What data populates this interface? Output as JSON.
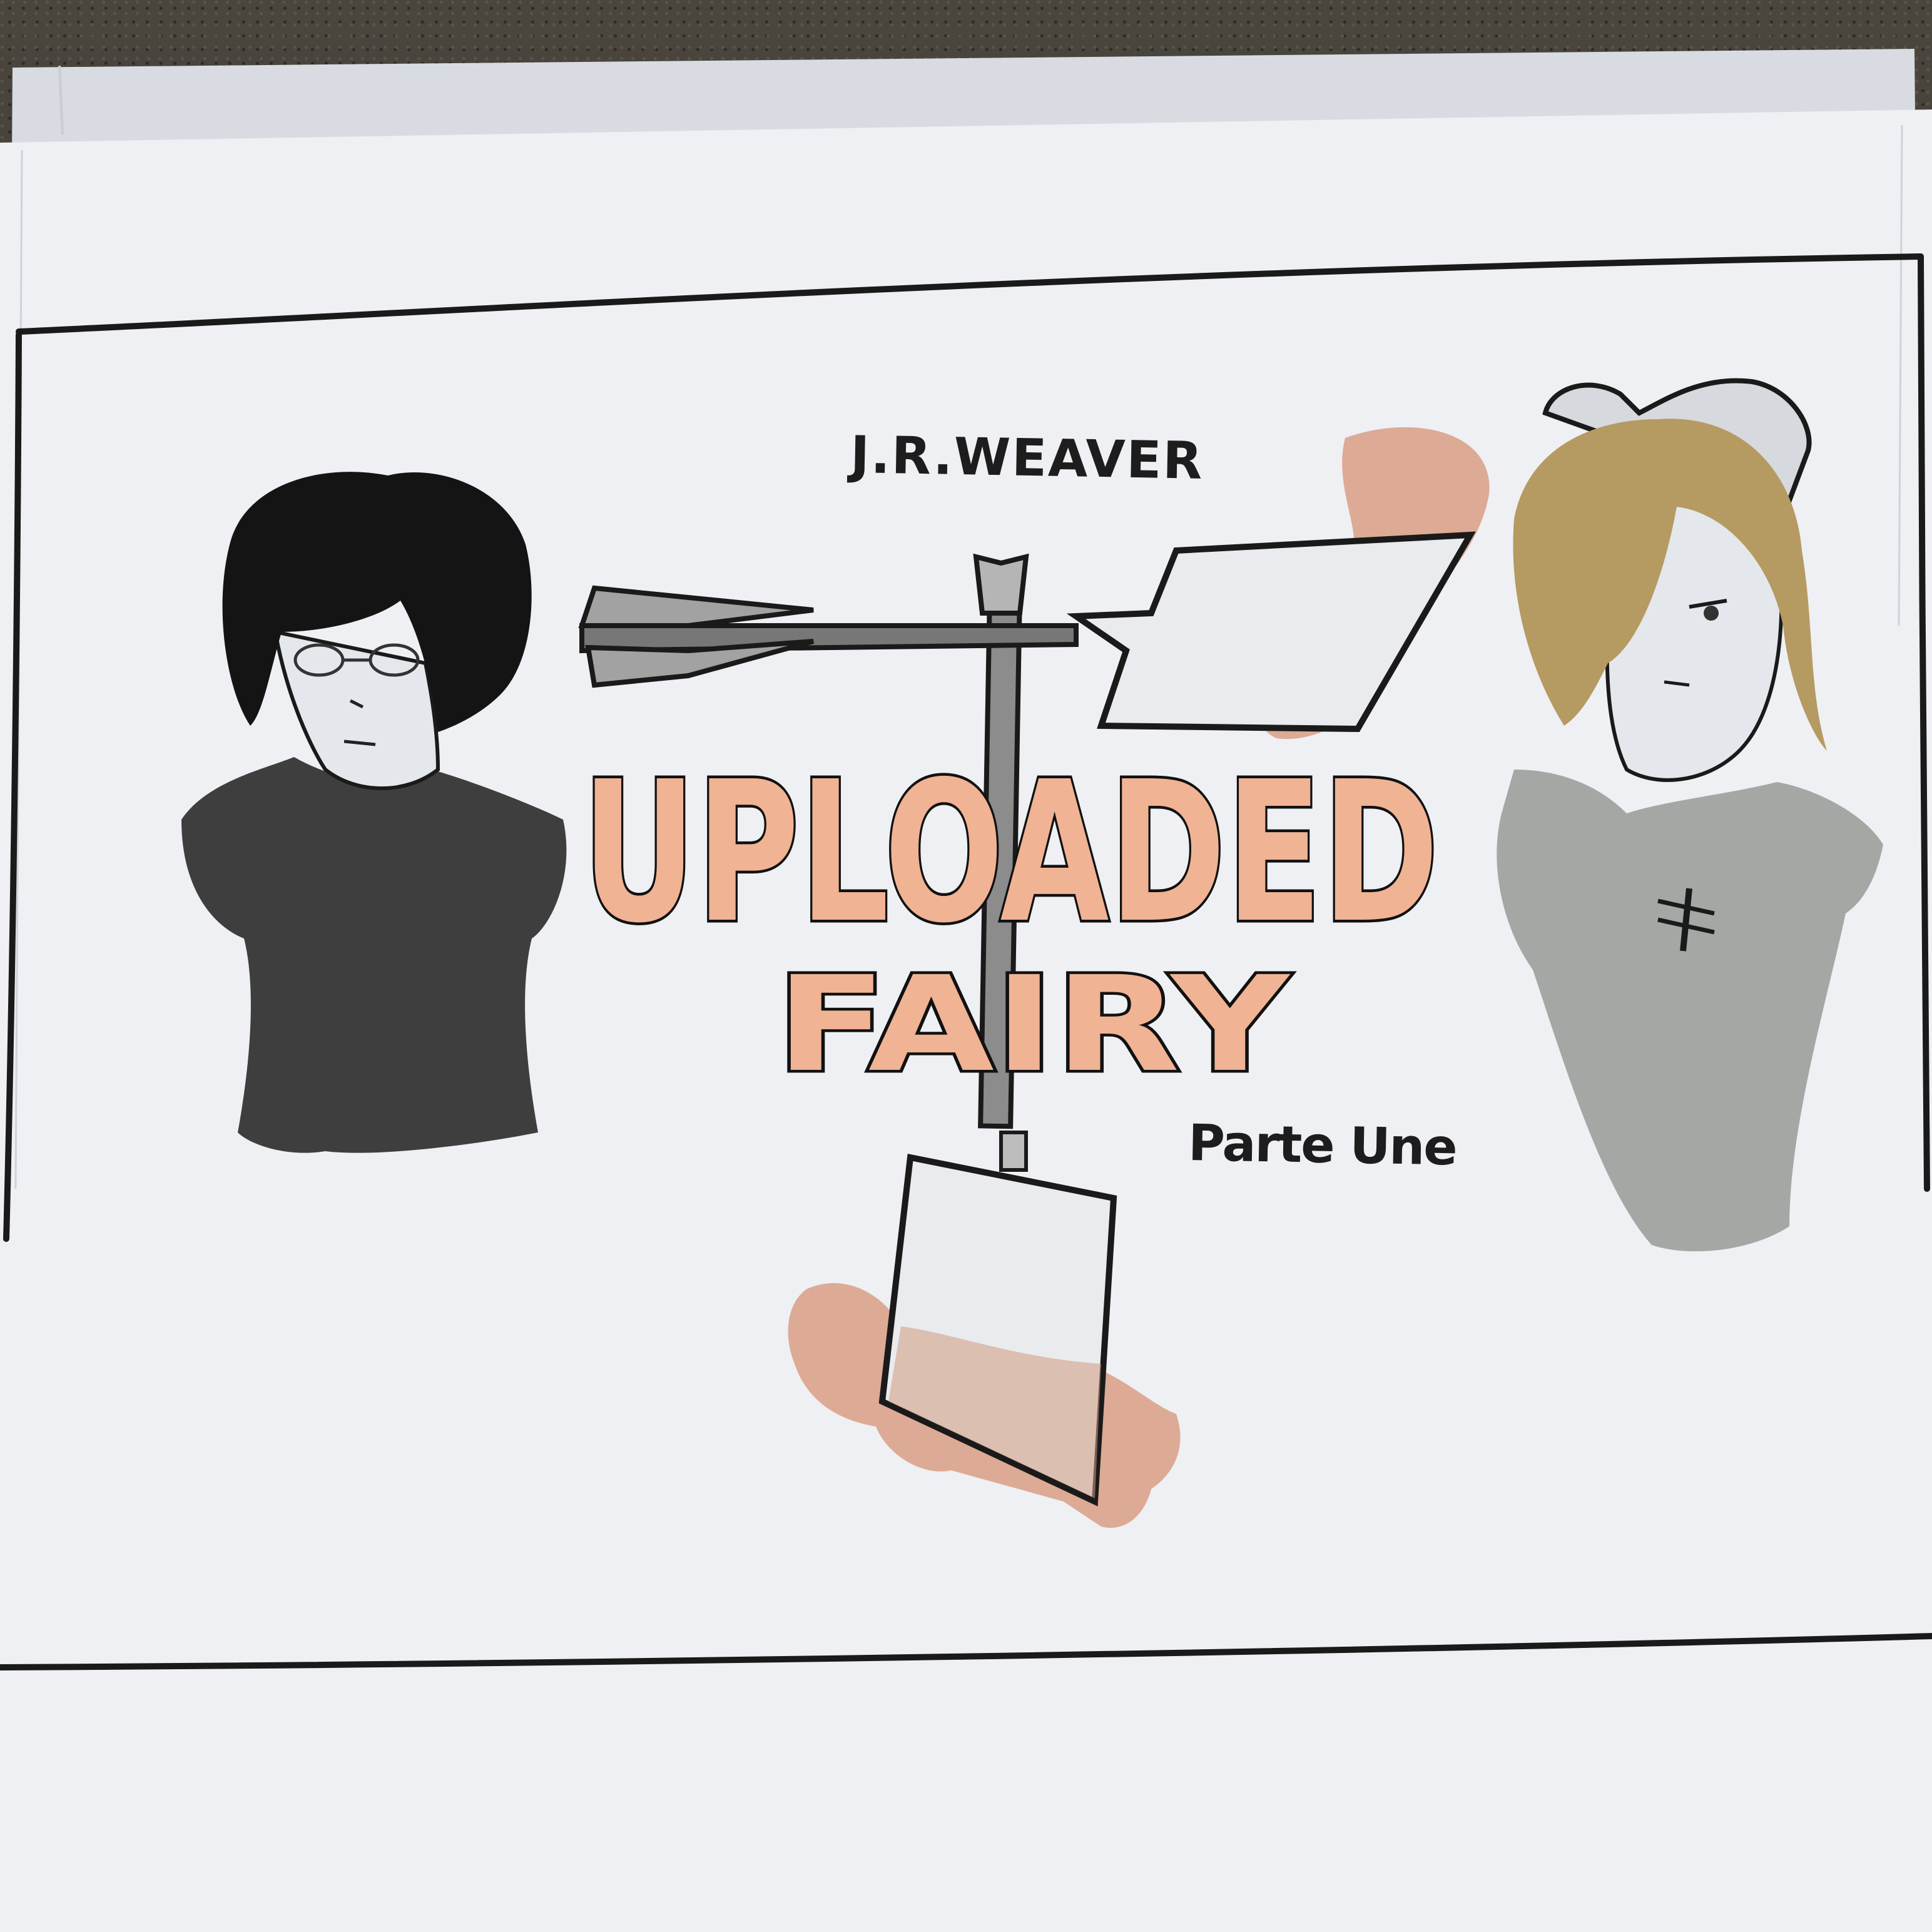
{
  "cover": {
    "author": "J.R.WEAVER",
    "title_line_1": "UPLOADED",
    "title_line_2": "FAIRY",
    "subtitle": "Parte Une"
  },
  "colors": {
    "paper": "#eef0f3",
    "ink": "#1a1a1a",
    "peach_wash": "#d9967a",
    "title_fill": "#f0b394",
    "blonde_hair": "#b59a62",
    "grey_shirt": "#a3a8a5",
    "dark_shirt": "#3e3e3e",
    "fabric": "#3d3a36"
  },
  "figures": {
    "left": "dark-haired girl with glasses in a dark shirt",
    "right": "blonde girl with bow in a grey shirt"
  },
  "icons": {
    "center": "weathervane-icon"
  }
}
